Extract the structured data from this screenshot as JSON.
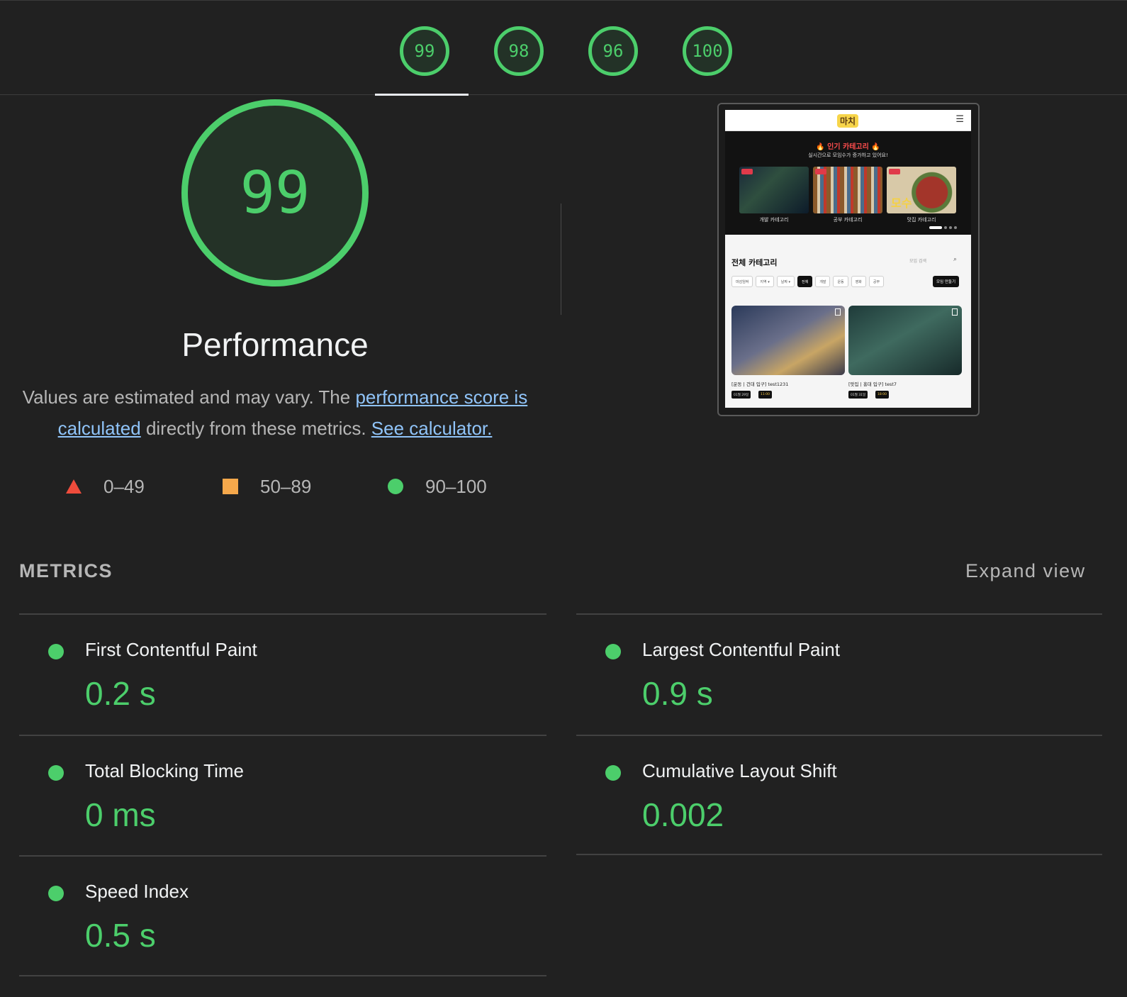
{
  "tabs": {
    "scores": [
      "99",
      "98",
      "96",
      "100"
    ]
  },
  "main_score": {
    "value": "99",
    "title": "Performance"
  },
  "description": {
    "text_1": "Values are estimated and may vary. The ",
    "link_1": "performance score is calculated",
    "text_2": " directly from these metrics. ",
    "link_2": "See calculator."
  },
  "legend": {
    "fail": "0–49",
    "average": "50–89",
    "pass": "90–100"
  },
  "colors": {
    "pass": "#4cce6b",
    "average": "#f5a84b",
    "fail": "#ef4c3c",
    "background": "#212121",
    "link": "#90c4f9"
  },
  "screenshot": {
    "logo": "마치",
    "banner_title": "🔥 인기 카테고리 🔥",
    "banner_sub": "실시간으로 모임수가 증가하고 있어요!",
    "cards": [
      "개발 카테고리",
      "공부 카테고리",
      "맛집 카테고리"
    ],
    "section_title": "전체 카테고리",
    "search_placeholder": "모임 검색",
    "filters": [
      "마감임박",
      "지역 ▾",
      "날짜 ▾",
      "전체",
      "개발",
      "운동",
      "영화",
      "공부",
      "맛집"
    ],
    "make_button": "모임 만들기",
    "posts": [
      {
        "title": "[운동 | 건대 입구] test1231",
        "date": "01월 29일",
        "time": "11:00"
      },
      {
        "title": "[맛집 | 홍대 입구] test7",
        "date": "01월 31일",
        "time": "18:00"
      }
    ],
    "card_text": "모수"
  },
  "metrics": {
    "label": "METRICS",
    "expand": "Expand view",
    "items": [
      {
        "name": "First Contentful Paint",
        "value": "0.2 s"
      },
      {
        "name": "Largest Contentful Paint",
        "value": "0.9 s"
      },
      {
        "name": "Total Blocking Time",
        "value": "0 ms"
      },
      {
        "name": "Cumulative Layout Shift",
        "value": "0.002"
      },
      {
        "name": "Speed Index",
        "value": "0.5 s"
      }
    ]
  }
}
